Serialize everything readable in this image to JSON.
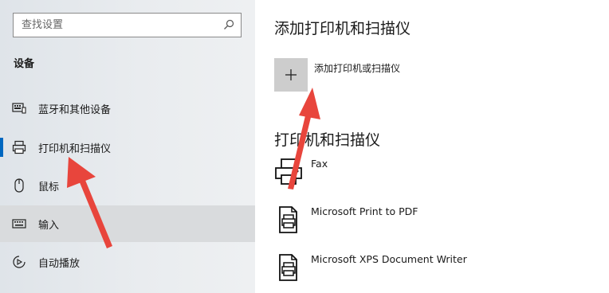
{
  "search": {
    "placeholder": "查找设置"
  },
  "sidebar": {
    "section_title": "设备",
    "items": [
      {
        "label": "蓝牙和其他设备",
        "icon": "bluetooth-devices-icon"
      },
      {
        "label": "打印机和扫描仪",
        "icon": "printer-icon",
        "selected": true
      },
      {
        "label": "鼠标",
        "icon": "mouse-icon"
      },
      {
        "label": "输入",
        "icon": "keyboard-icon",
        "hovered": true
      },
      {
        "label": "自动播放",
        "icon": "autoplay-icon"
      }
    ]
  },
  "main": {
    "add_heading": "添加打印机和扫描仪",
    "add_button_label": "添加打印机或扫描仪",
    "list_heading": "打印机和扫描仪",
    "devices": [
      {
        "name": "Fax",
        "icon": "fax-icon"
      },
      {
        "name": "Microsoft Print to PDF",
        "icon": "document-printer-icon"
      },
      {
        "name": "Microsoft XPS Document Writer",
        "icon": "document-printer-icon"
      }
    ]
  },
  "colors": {
    "accent": "#0067c0",
    "annotation_arrow": "#e8453c",
    "sidebar_bg": "#e6e9ec",
    "hover_bg": "#d9dbdd",
    "add_tile_bg": "#cdcdcd"
  }
}
